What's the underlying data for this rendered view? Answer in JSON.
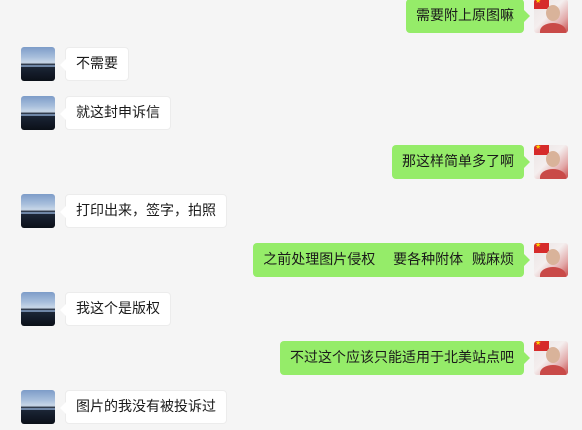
{
  "messages": [
    {
      "side": "right",
      "text": "需要附上原图嘛",
      "avatar": "user-avatar-self"
    },
    {
      "side": "left",
      "text": "不需要",
      "avatar": "user-avatar-contact"
    },
    {
      "side": "left",
      "text": "就这封申诉信",
      "avatar": "user-avatar-contact"
    },
    {
      "side": "right",
      "text": "那这样简单多了啊",
      "avatar": "user-avatar-self"
    },
    {
      "side": "left",
      "text": "打印出来，签字，拍照",
      "avatar": "user-avatar-contact"
    },
    {
      "side": "right",
      "text": "之前处理图片侵权    要各种附体  贼麻烦",
      "avatar": "user-avatar-self"
    },
    {
      "side": "left",
      "text": "我这个是版权",
      "avatar": "user-avatar-contact"
    },
    {
      "side": "right",
      "text": "不过这个应该只能适用于北美站点吧",
      "avatar": "user-avatar-self"
    },
    {
      "side": "left",
      "text": "图片的我没有被投诉过",
      "avatar": "user-avatar-contact"
    }
  ],
  "colors": {
    "background": "#f5f5f5",
    "self_bubble": "#95ec69",
    "contact_bubble": "#ffffff"
  }
}
